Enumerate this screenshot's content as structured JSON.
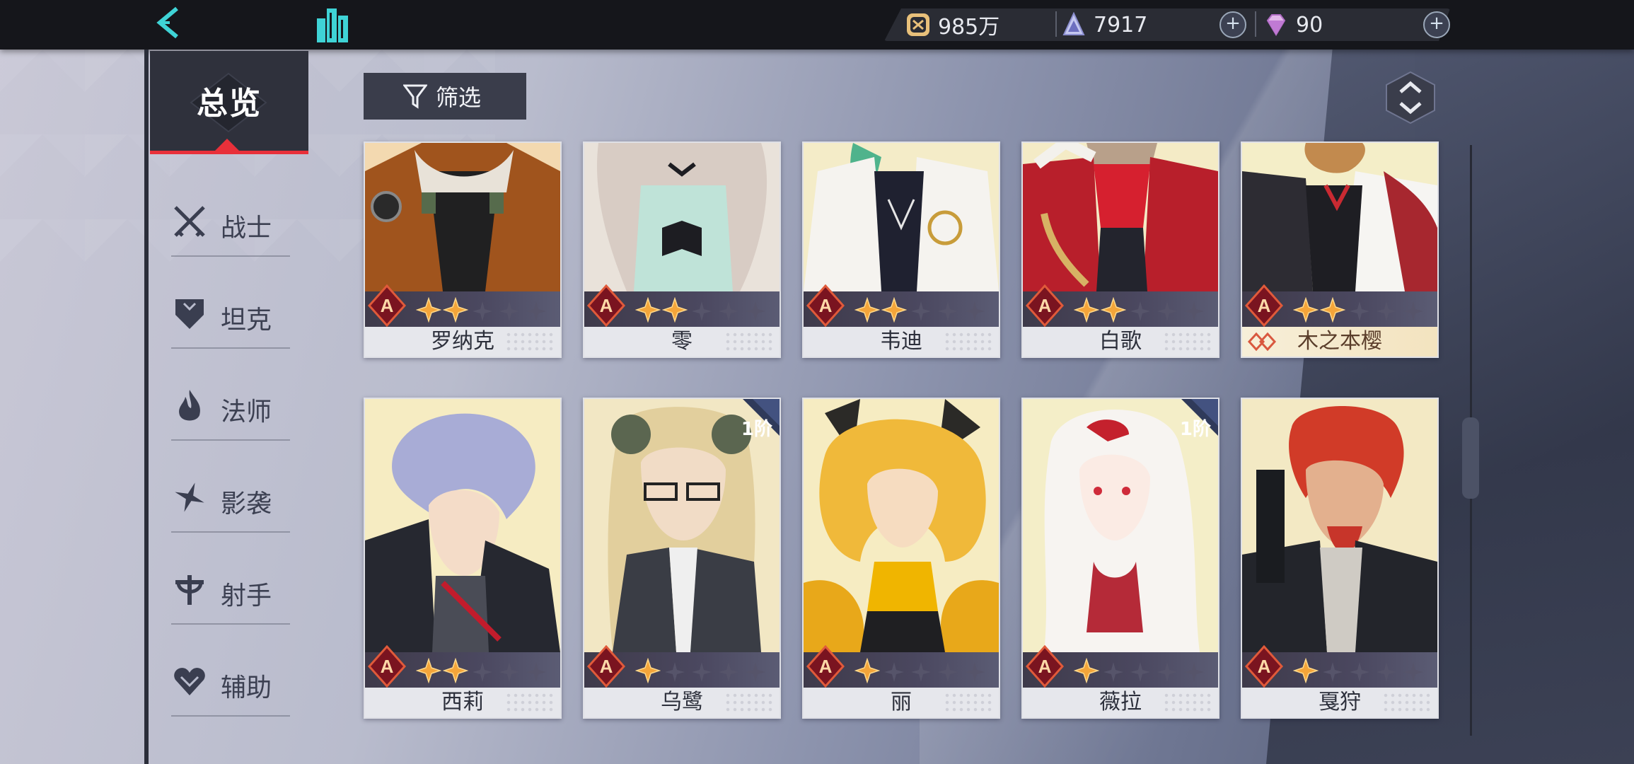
{
  "resources": {
    "gold": "985万",
    "crystal": "7917",
    "gem": "90"
  },
  "nav": {
    "overview": "总览",
    "items": [
      {
        "label": "战士",
        "icon": "swords-icon"
      },
      {
        "label": "坦克",
        "icon": "shield-icon"
      },
      {
        "label": "法师",
        "icon": "flame-icon"
      },
      {
        "label": "影袭",
        "icon": "shuriken-icon"
      },
      {
        "label": "射手",
        "icon": "crosshair-icon"
      },
      {
        "label": "辅助",
        "icon": "heart-icon"
      }
    ]
  },
  "filter": {
    "label": "筛选"
  },
  "cards": [
    {
      "name": "罗纳克",
      "grade": "A",
      "stars": 2,
      "tier": ""
    },
    {
      "name": "零",
      "grade": "A",
      "stars": 2,
      "tier": ""
    },
    {
      "name": "韦迪",
      "grade": "A",
      "stars": 2,
      "tier": ""
    },
    {
      "name": "白歌",
      "grade": "A",
      "stars": 2,
      "tier": ""
    },
    {
      "name": "木之本樱",
      "grade": "A",
      "stars": 2,
      "tier": "",
      "collab": true
    },
    {
      "name": "西莉",
      "grade": "A",
      "stars": 2,
      "tier": ""
    },
    {
      "name": "乌鹭",
      "grade": "A",
      "stars": 1,
      "tier": "1阶"
    },
    {
      "name": "丽",
      "grade": "A",
      "stars": 1,
      "tier": ""
    },
    {
      "name": "薇拉",
      "grade": "A",
      "stars": 1,
      "tier": "1阶"
    },
    {
      "name": "戛狩",
      "grade": "A",
      "stars": 1,
      "tier": ""
    }
  ],
  "colors": {
    "accent_red": "#e8303a",
    "topbar": "#15161b",
    "teal_icon": "#3fd3d6"
  }
}
